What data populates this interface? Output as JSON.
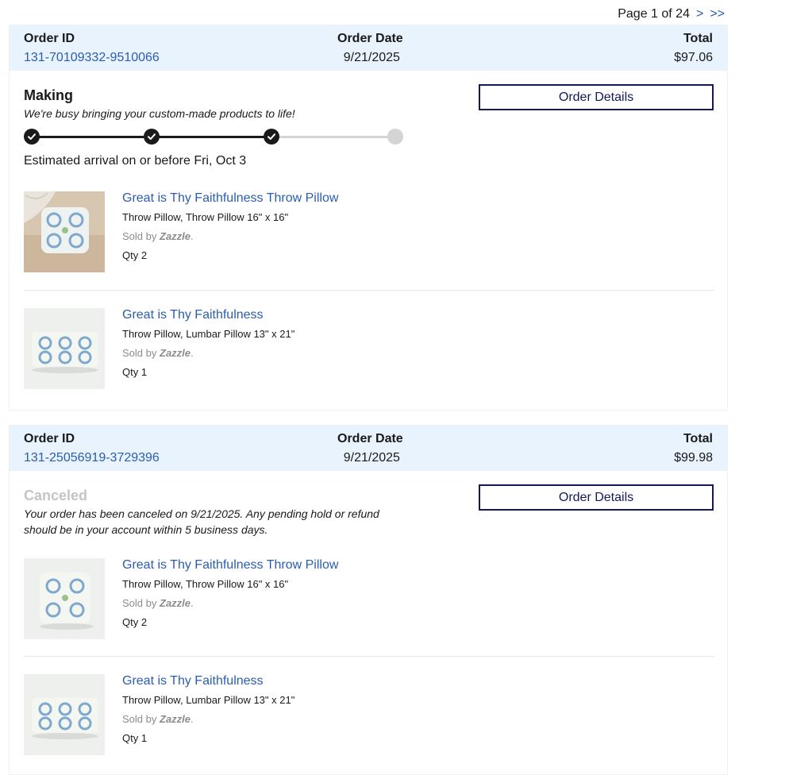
{
  "pagination": {
    "page_text": "Page 1 of 24",
    "next": ">",
    "last": ">>"
  },
  "labels": {
    "order_id": "Order ID",
    "order_date": "Order Date",
    "total": "Total",
    "order_details": "Order Details",
    "sold_by": "Sold by",
    "brand": "Zazzle"
  },
  "orders": [
    {
      "order_id": "131-70109332-9510066",
      "date": "9/21/2025",
      "total": "$97.06",
      "status": "Making",
      "status_color": "#1a1a1a",
      "status_message": "We're busy bringing your custom-made products to life!",
      "progress_completed_steps": 3,
      "progress_total_steps": 4,
      "eta": "Estimated arrival on or before Fri, Oct 3",
      "items": [
        {
          "title": "Great is Thy Faithfulness Throw Pillow",
          "description": "Throw Pillow, Throw Pillow 16\" x 16\"",
          "qty": "Qty 2",
          "image": "square-pillow-on-rug"
        },
        {
          "title": "Great is Thy Faithfulness",
          "description": "Throw Pillow, Lumbar Pillow 13\" x 21\"",
          "qty": "Qty 1",
          "image": "lumbar-pillow"
        }
      ]
    },
    {
      "order_id": "131-25056919-3729396",
      "date": "9/21/2025",
      "total": "$99.98",
      "status": "Canceled",
      "status_color": "#c4c4c4",
      "status_message": "Your order has been canceled on 9/21/2025. Any pending hold or refund should be in your account within 5 business days.",
      "items": [
        {
          "title": "Great is Thy Faithfulness Throw Pillow",
          "description": "Throw Pillow, Throw Pillow 16\" x 16\"",
          "qty": "Qty 2",
          "image": "square-pillow"
        },
        {
          "title": "Great is Thy Faithfulness",
          "description": "Throw Pillow, Lumbar Pillow 13\" x 21\"",
          "qty": "Qty 1",
          "image": "lumbar-pillow"
        }
      ]
    }
  ]
}
